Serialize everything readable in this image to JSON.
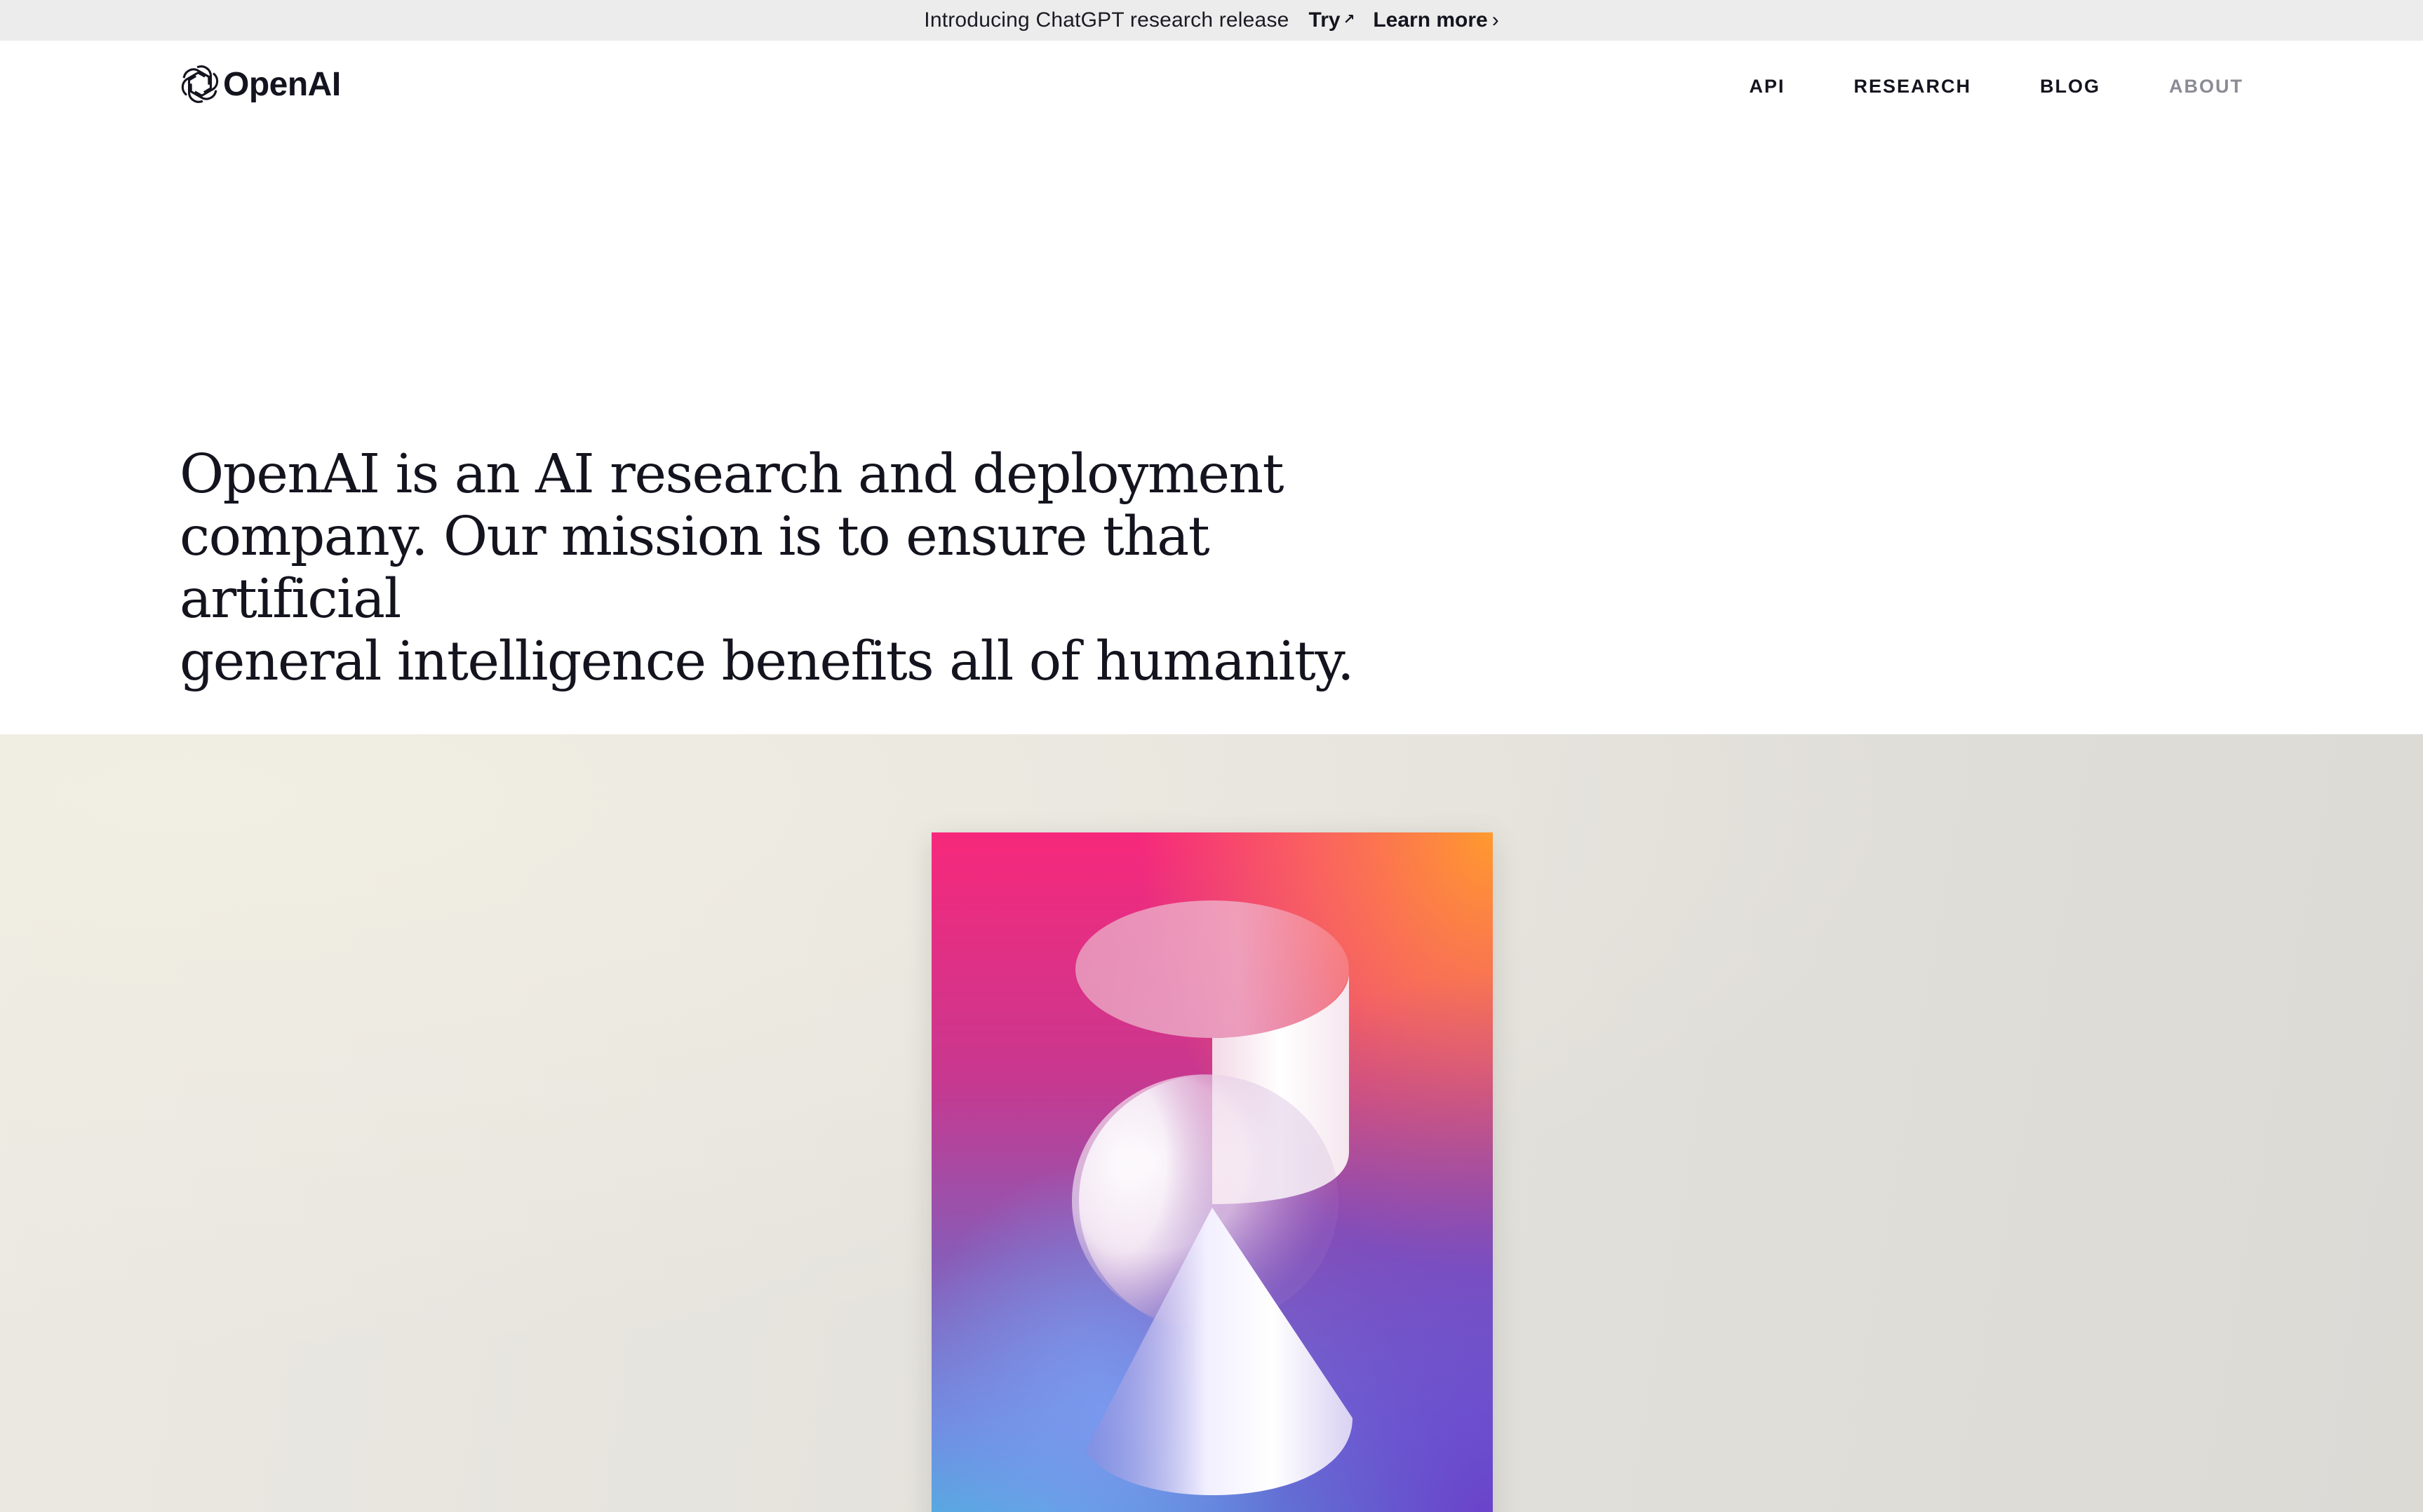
{
  "announcement": {
    "text": "Introducing ChatGPT research release",
    "try_label": "Try",
    "learn_more_label": "Learn more"
  },
  "header": {
    "logo_text": "OpenAI",
    "nav": [
      {
        "label": "API"
      },
      {
        "label": "RESEARCH"
      },
      {
        "label": "BLOG"
      },
      {
        "label": "ABOUT"
      }
    ]
  },
  "hero": {
    "line1": "OpenAI is an AI research and deployment",
    "line2": "company. Our mission is to ensure that artificial",
    "line3": "general intelligence benefits all of humanity."
  },
  "colors": {
    "text": "#14141f",
    "announcement_bg": "#ececec",
    "nav_muted": "#8b8b95",
    "art_background": "#e4e2dc"
  },
  "icons": {
    "logo": "openai-logo-icon",
    "try_arrow": "arrow-up-right-icon",
    "learn_more_arrow": "chevron-right-icon"
  }
}
